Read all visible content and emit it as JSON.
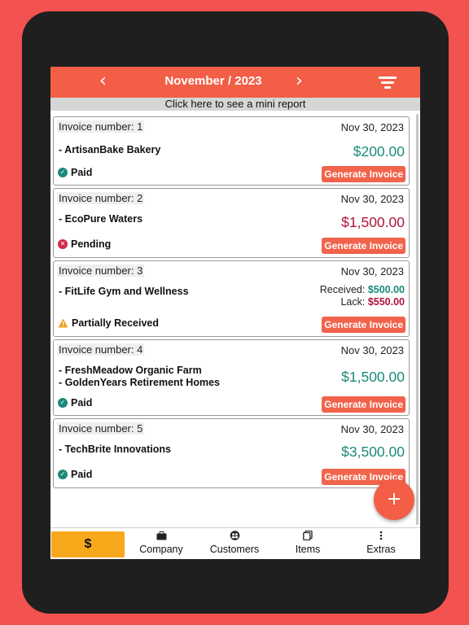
{
  "header": {
    "title": "November / 2023",
    "prev_icon": "chevron-left-icon",
    "next_icon": "chevron-right-icon",
    "filter_icon": "filter-icon",
    "color": "#f25e46"
  },
  "mini_report": {
    "label": "Click here to see a mini report"
  },
  "invoices": [
    {
      "number_label": "Invoice number: 1",
      "date": "Nov 30, 2023",
      "customers": [
        "- ArtisanBake Bakery"
      ],
      "amount": "$200.00",
      "status": "Paid",
      "status_icon": "check-circle-icon",
      "button": "Generate Invoice"
    },
    {
      "number_label": "Invoice number: 2",
      "date": "Nov 30, 2023",
      "customers": [
        "- EcoPure Waters"
      ],
      "amount": "$1,500.00",
      "status": "Pending",
      "status_icon": "x-circle-icon",
      "button": "Generate Invoice"
    },
    {
      "number_label": "Invoice number: 3",
      "date": "Nov 30, 2023",
      "customers": [
        "- FitLife Gym and Wellness"
      ],
      "received_label": "Received:",
      "received": "$500.00",
      "lack_label": "Lack:",
      "lack": "$550.00",
      "status": "Partially Received",
      "status_icon": "warning-icon",
      "button": "Generate Invoice"
    },
    {
      "number_label": "Invoice number: 4",
      "date": "Nov 30, 2023",
      "customers": [
        "- FreshMeadow Organic Farm",
        "- GoldenYears Retirement Homes"
      ],
      "amount": "$1,500.00",
      "status": "Paid",
      "status_icon": "check-circle-icon",
      "button": "Generate Invoice"
    },
    {
      "number_label": "Invoice number: 5",
      "date": "Nov 30, 2023",
      "customers": [
        "- TechBrite Innovations"
      ],
      "amount": "$3,500.00",
      "status": "Paid",
      "status_icon": "check-circle-icon",
      "button": "Generate Invoice"
    }
  ],
  "fab": {
    "label": "+"
  },
  "nav": {
    "active_symbol": "$",
    "items": [
      {
        "label": "Company",
        "icon": "briefcase-icon"
      },
      {
        "label": "Customers",
        "icon": "users-icon"
      },
      {
        "label": "Items",
        "icon": "documents-icon"
      },
      {
        "label": "Extras",
        "icon": "more-vertical-icon"
      }
    ]
  },
  "colors": {
    "paid": "#1a8a7a",
    "pending": "#b0143a",
    "button": "#f2634b",
    "nav_active": "#f7a81b",
    "background": "#f25250"
  }
}
